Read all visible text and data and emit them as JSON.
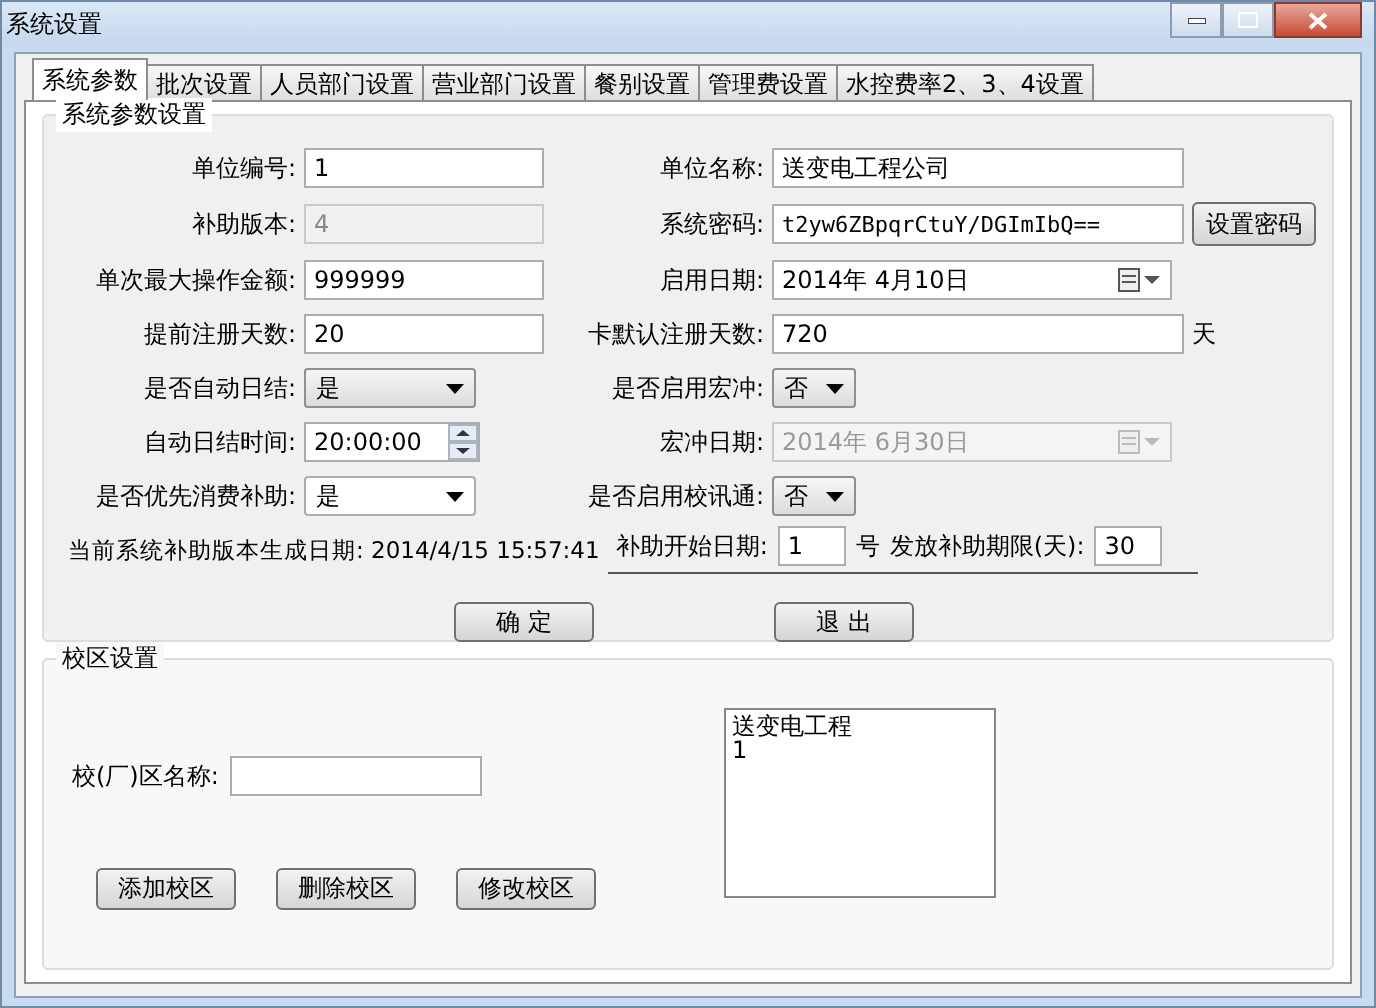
{
  "window": {
    "title": "系统设置"
  },
  "tabs": [
    {
      "label": "系统参数",
      "selected": true
    },
    {
      "label": "批次设置",
      "selected": false
    },
    {
      "label": "人员部门设置",
      "selected": false
    },
    {
      "label": "营业部门设置",
      "selected": false
    },
    {
      "label": "餐别设置",
      "selected": false
    },
    {
      "label": "管理费设置",
      "selected": false
    },
    {
      "label": "水控费率2、3、4设置",
      "selected": false
    }
  ],
  "system_group": {
    "title": "系统参数设置",
    "fields": [
      {
        "label": "单位编号:",
        "kind": "text",
        "value": "1",
        "disabled": false
      },
      {
        "label": "单位名称:",
        "kind": "text",
        "value": "送变电工程公司",
        "disabled": false
      },
      {
        "label": "补助版本:",
        "kind": "text",
        "value": "4",
        "disabled": true
      },
      {
        "label": "系统密码:",
        "kind": "text",
        "value": "t2yw6ZBpqrCtuY/DGImIbQ==",
        "disabled": false,
        "button": "设置密码"
      },
      {
        "label": "单次最大操作金额:",
        "kind": "text",
        "value": "999999",
        "disabled": false
      },
      {
        "label": "启用日期:",
        "kind": "date",
        "value": "2014年 4月10日",
        "disabled": false
      },
      {
        "label": "提前注册天数:",
        "kind": "text",
        "value": "20",
        "disabled": false
      },
      {
        "label": "卡默认注册天数:",
        "kind": "text",
        "value": "720",
        "disabled": false,
        "unit": "天"
      },
      {
        "label": "是否自动日结:",
        "kind": "select",
        "value": "是",
        "disabled": false
      },
      {
        "label": "是否启用宏冲:",
        "kind": "select",
        "value": "否",
        "disabled": false
      },
      {
        "label": "自动日结时间:",
        "kind": "spin",
        "value": "20:00:00",
        "disabled": false
      },
      {
        "label": "宏冲日期:",
        "kind": "date",
        "value": "2014年 6月30日",
        "disabled": true
      },
      {
        "label": "是否优先消费补助:",
        "kind": "select",
        "value": "是",
        "disabled": false
      },
      {
        "label": "是否启用校讯通:",
        "kind": "select",
        "value": "否",
        "disabled": false
      }
    ],
    "version_info": "当前系统补助版本生成日期: 2014/4/15 15:57:41",
    "subsidy": {
      "start_label": "补助开始日期:",
      "start_value": "1",
      "start_unit": "号",
      "period_label": "发放补助期限(天):",
      "period_value": "30"
    }
  },
  "buttons": [
    "确 定",
    "退 出"
  ],
  "campus_group": {
    "title": "校区设置",
    "name_label": "校(厂)区名称:",
    "buttons": [
      "添加校区",
      "删除校区",
      "修改校区"
    ],
    "list_items": [
      "送变电工程",
      "1"
    ]
  }
}
